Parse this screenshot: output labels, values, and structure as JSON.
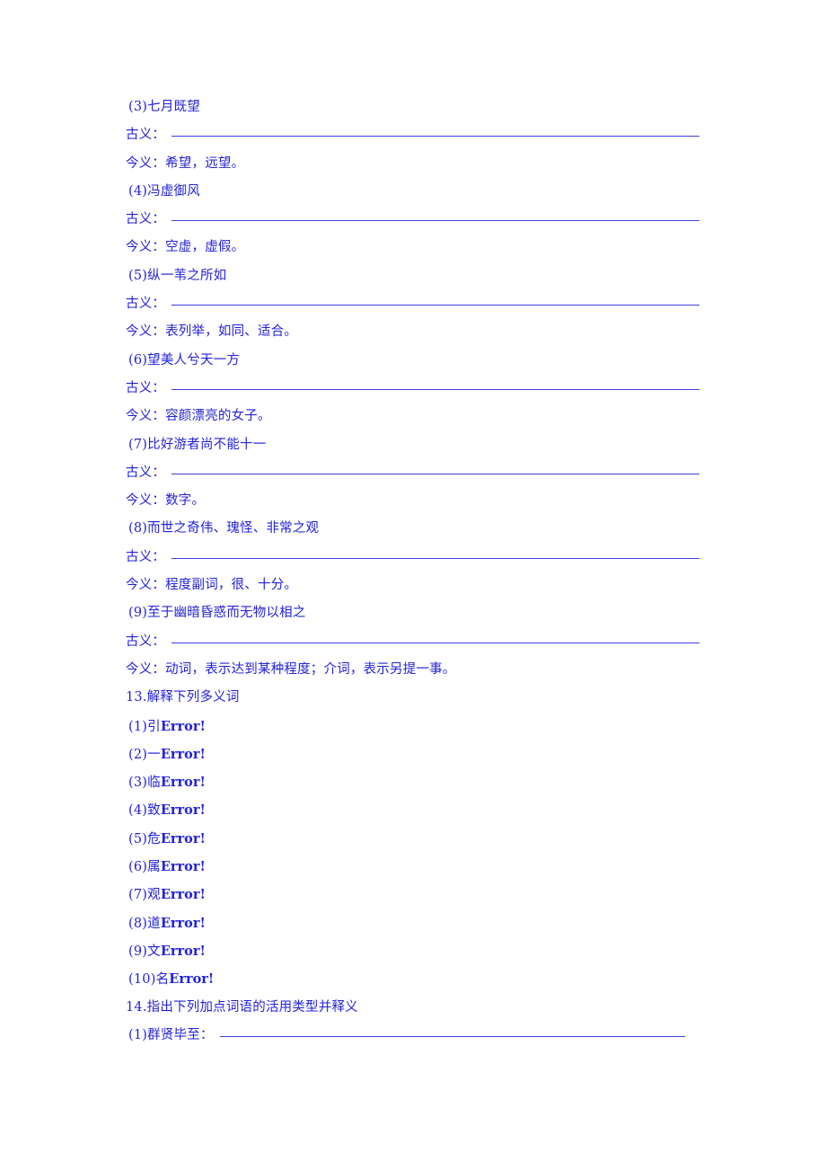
{
  "document": {
    "text_color": "#2222dd",
    "rule_color": "#3f3fe0",
    "background": "#ffffff",
    "ancient_label": "古义：",
    "modern_label": "今义："
  },
  "entries": [
    {
      "heading": "(3)七月既望",
      "ancient_label": "古义：",
      "ancient_value": "",
      "modern_label": "今义：",
      "modern_value": "希望，远望。"
    },
    {
      "heading": "(4)冯虚御风",
      "ancient_label": "古义：",
      "ancient_value": "",
      "modern_label": "今义：",
      "modern_value": "空虚，虚假。"
    },
    {
      "heading": "(5)纵一苇之所如",
      "ancient_label": "古义：",
      "ancient_value": "",
      "modern_label": "今义：",
      "modern_value": "表列举，如同、适合。"
    },
    {
      "heading": "(6)望美人兮天一方",
      "ancient_label": "古义：",
      "ancient_value": "",
      "modern_label": "今义：",
      "modern_value": "容颜漂亮的女子。"
    },
    {
      "heading": "(7)比好游者尚不能十一",
      "ancient_label": "古义：",
      "ancient_value": "",
      "modern_label": "今义：",
      "modern_value": "数字。"
    },
    {
      "heading": "(8)而世之奇伟、瑰怪、非常之观",
      "ancient_label": "古义：",
      "ancient_value": "",
      "modern_label": "今义：",
      "modern_value": "程度副词，很、十分。"
    },
    {
      "heading": "(9)至于幽暗昏惑而无物以相之",
      "ancient_label": "古义：",
      "ancient_value": "",
      "modern_label": "今义：",
      "modern_value": "动词，表示达到某种程度；介词，表示另提一事。"
    }
  ],
  "section13": {
    "heading": "13.解释下列多义词",
    "items": [
      {
        "marker": "(1)",
        "word": "引",
        "error": "Error!"
      },
      {
        "marker": "(2)",
        "word": "一",
        "error": "Error!"
      },
      {
        "marker": "(3)",
        "word": "临",
        "error": "Error!"
      },
      {
        "marker": "(4)",
        "word": "致",
        "error": "Error!"
      },
      {
        "marker": "(5)",
        "word": "危",
        "error": "Error!"
      },
      {
        "marker": "(6)",
        "word": "属",
        "error": "Error!"
      },
      {
        "marker": "(7)",
        "word": "观",
        "error": "Error!"
      },
      {
        "marker": "(8)",
        "word": "道",
        "error": "Error!"
      },
      {
        "marker": "(9)",
        "word": "文",
        "error": "Error!"
      },
      {
        "marker": "(10)",
        "word": "名",
        "error": "Error!"
      }
    ]
  },
  "section14": {
    "heading": "14.指出下列加点词语的活用类型并释义",
    "items": [
      {
        "label": "(1)群贤毕至：",
        "value": ""
      }
    ]
  }
}
